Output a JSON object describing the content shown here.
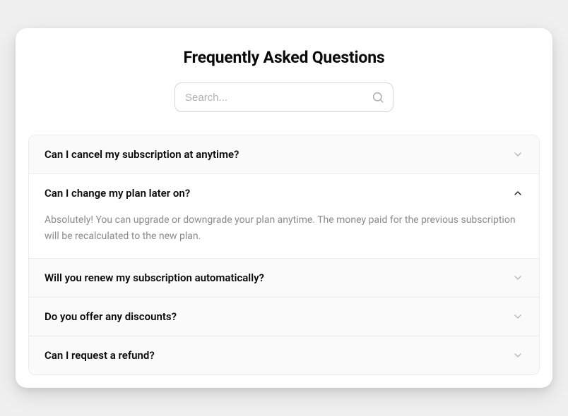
{
  "title": "Frequently Asked Questions",
  "search": {
    "placeholder": "Search..."
  },
  "faq": [
    {
      "question": "Can I cancel my subscription at anytime?",
      "open": false
    },
    {
      "question": "Can I change my plan later on?",
      "answer": "Absolutely! You can upgrade or downgrade your plan anytime. The money paid for the previous subscription will be recalculated to the new plan.",
      "open": true
    },
    {
      "question": "Will you renew my subscription automatically?",
      "open": false
    },
    {
      "question": "Do you offer any discounts?",
      "open": false
    },
    {
      "question": "Can I request a refund?",
      "open": false
    }
  ]
}
